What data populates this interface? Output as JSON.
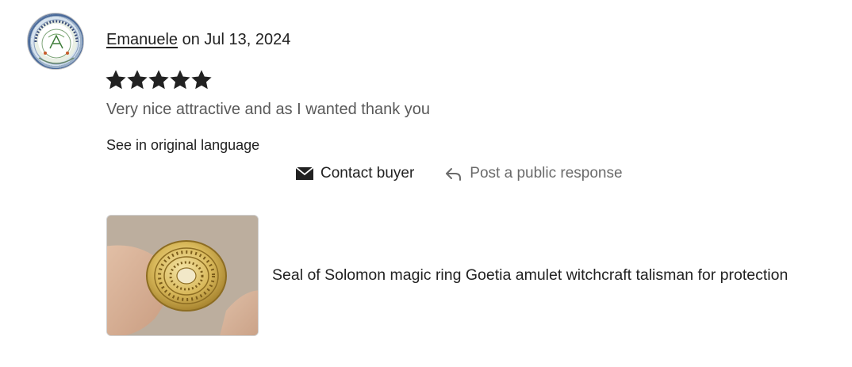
{
  "review": {
    "author": "Emanuele",
    "date_text": "on Jul 13, 2024",
    "rating": 5,
    "rating_max": 5,
    "text": "Very nice attractive and as I wanted thank you",
    "translate_link": "See in original language",
    "avatar_logo_text": "MAESTRO EMANUELE"
  },
  "actions": {
    "contact_label": "Contact buyer",
    "contact_icon": "envelope-icon",
    "respond_label": "Post a public response",
    "respond_icon": "reply-arrow-icon"
  },
  "listing": {
    "title": "Seal of Solomon magic ring Goetia amulet witchcraft talisman for protection"
  },
  "colors": {
    "text_primary": "#222222",
    "text_secondary": "#595959",
    "text_muted": "#6b6b6b",
    "star": "#222222"
  }
}
